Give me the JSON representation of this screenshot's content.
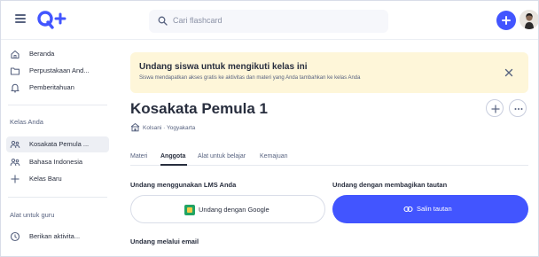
{
  "header": {
    "search_placeholder": "Cari flashcard"
  },
  "sidebar": {
    "nav": [
      {
        "label": "Beranda",
        "icon": "home-icon"
      },
      {
        "label": "Perpustakaan And...",
        "icon": "folder-icon"
      },
      {
        "label": "Pemberitahuan",
        "icon": "bell-icon"
      }
    ],
    "classes_heading": "Kelas Anda",
    "classes": [
      {
        "label": "Kosakata Pemula ...",
        "icon": "class-group-icon",
        "active": true
      },
      {
        "label": "Bahasa Indonesia",
        "icon": "class-group-icon",
        "active": false
      },
      {
        "label": "Kelas Baru",
        "icon": "plus-icon",
        "active": false
      }
    ],
    "tools_heading": "Alat untuk guru",
    "tools": [
      {
        "label": "Berikan aktivita...",
        "icon": "clock-icon"
      }
    ]
  },
  "banner": {
    "title": "Undang siswa untuk mengikuti kelas ini",
    "subtitle": "Siswa mendapatkan akses gratis ke aktivitas dan materi yang Anda tambahkan ke kelas Anda"
  },
  "class": {
    "title": "Kosakata Pemula 1",
    "school": "Kolsani · Yogyakarta"
  },
  "tabs": [
    {
      "label": "Materi",
      "active": false
    },
    {
      "label": "Anggota",
      "active": true
    },
    {
      "label": "Alat untuk belajar",
      "active": false
    },
    {
      "label": "Kemajuan",
      "active": false
    }
  ],
  "invite": {
    "lms_heading": "Undang menggunakan LMS Anda",
    "link_heading": "Undang dengan membagikan tautan",
    "google_button": "Undang dengan Google",
    "copy_button": "Salin tautan",
    "email_heading": "Undang melalui email"
  },
  "colors": {
    "accent": "#4255ff",
    "banner_bg": "#fef6d9",
    "text": "#282e3e",
    "muted": "#586380"
  }
}
